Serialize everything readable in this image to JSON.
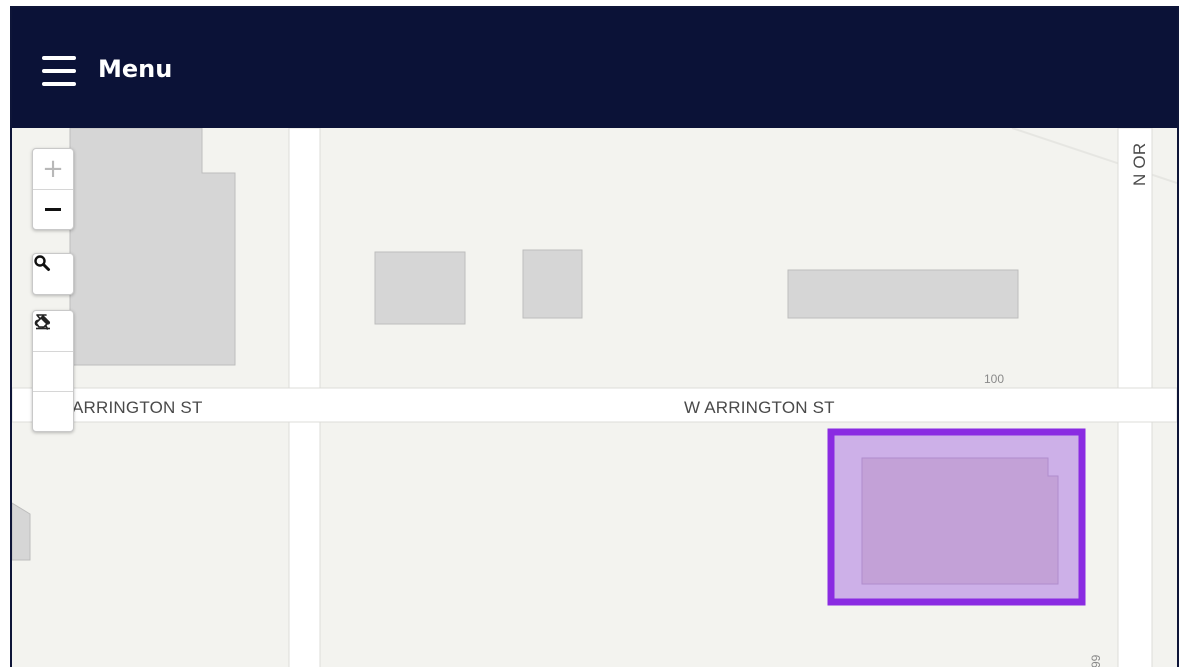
{
  "header": {
    "menu_label": "Menu",
    "menu_icon": "hamburger-icon",
    "background": "#0b1237"
  },
  "map": {
    "streets": {
      "main_horizontal": "W ARRINGTON ST",
      "left_partial": "ARRINGTON ST",
      "vertical_right": "N OR"
    },
    "address_labels": {
      "north_parcel": "100",
      "south_parcel": "99"
    },
    "selected_parcel": {
      "outline_color": "#8a2be2",
      "fill_color": "#cdb0e8"
    }
  },
  "controls": {
    "zoom": [
      "zoom-in-icon",
      "zoom-out-icon"
    ],
    "search": "search-icon",
    "tools": [
      "select-tool-icon",
      "cut-tool-icon",
      "eraser-icon"
    ]
  }
}
